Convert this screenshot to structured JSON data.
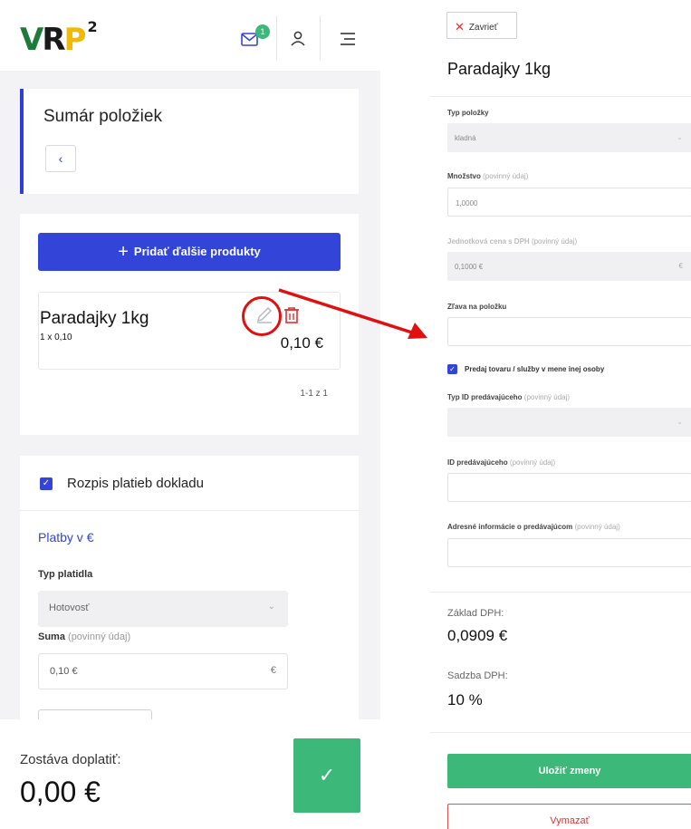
{
  "left_screen": {
    "logo": {
      "letter_v": "V",
      "letter_r": "R",
      "letter_p": "P",
      "superscript": "2"
    },
    "header": {
      "mail_badge": "1"
    },
    "summary_card": {
      "title": "Sumár položiek",
      "back_symbol": "‹"
    },
    "products_card": {
      "add_button_icon": "+",
      "add_button_label": "Pridať ďalšie produkty",
      "item": {
        "name": "Paradajky 1kg",
        "quantity_line": "1 x 0,10",
        "price": "0,10 €"
      },
      "pagination": "1-1 z 1"
    },
    "payments_card": {
      "checkbox_label": "Rozpis platieb dokladu",
      "section_title": "Platby v €",
      "payment_type_label": "Typ platidla",
      "payment_type_value": "Hotovosť",
      "amount_label": "Suma",
      "amount_hint": "(povinný údaj)",
      "amount_value": "0,10 €",
      "amount_unit": "€"
    },
    "footer": {
      "remaining_label": "Zostáva doplatiť:",
      "remaining_value": "0,00 €",
      "confirm_symbol": "✓"
    }
  },
  "right_panel": {
    "close_icon": "✕",
    "close_label": "Zavrieť",
    "title": "Paradajky 1kg",
    "fields": {
      "item_type": {
        "label": "Typ položky",
        "value": "kladná"
      },
      "quantity": {
        "label": "Množstvo",
        "hint": "(povinný údaj)",
        "value": "1,0000"
      },
      "unit_price": {
        "label": "Jednotková cena s DPH",
        "hint": "(povinný údaj)",
        "value": "0,1000 €",
        "unit": "€"
      },
      "discount": {
        "label": "Zľava na položku",
        "value": ""
      },
      "third_party_checkbox": "Predaj tovaru / služby v mene inej osoby",
      "seller_id_type": {
        "label": "Typ ID predávajúceho",
        "hint": "(povinný údaj)",
        "value": ""
      },
      "seller_id": {
        "label": "ID predávajúceho",
        "hint": "(povinný údaj)",
        "value": ""
      },
      "seller_address": {
        "label": "Adresné informácie o predávajúcom",
        "hint": "(povinný údaj)",
        "value": ""
      }
    },
    "vat_base_label": "Základ DPH:",
    "vat_base_value": "0,0909 €",
    "vat_rate_label": "Sadzba DPH:",
    "vat_rate_value": "10 %",
    "save_label": "Uložiť zmeny",
    "delete_label": "Vymazať"
  },
  "colors": {
    "primary_blue": "#3245d8",
    "success_green": "#3cb878",
    "danger_red": "#e01010",
    "logo_green": "#1e7a3a",
    "logo_yellow": "#f2b807"
  }
}
